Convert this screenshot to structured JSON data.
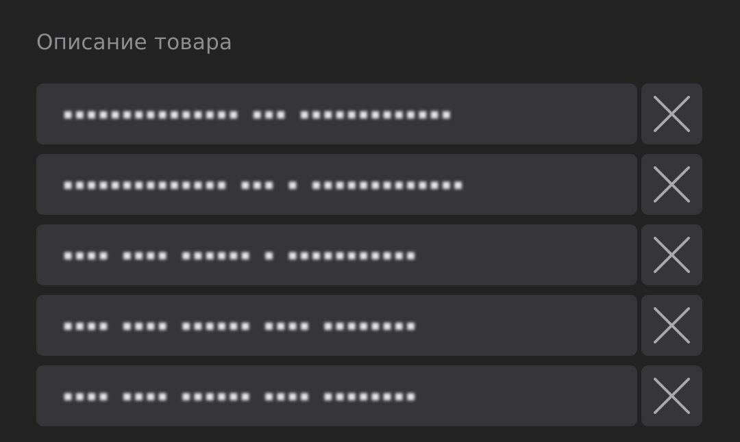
{
  "section": {
    "title": "Описание товара"
  },
  "items": [
    {
      "value": "▪︎▪︎▪︎▪︎▪︎▪︎▪︎▪︎▪︎▪︎▪︎▪︎▪︎▪︎▪︎ ▪︎▪︎▪︎ ▪︎▪︎▪︎▪︎▪︎▪︎▪︎▪︎▪︎▪︎▪︎▪︎▪︎"
    },
    {
      "value": "▪︎▪︎▪︎▪︎▪︎▪︎▪︎▪︎▪︎▪︎▪︎▪︎▪︎▪︎ ▪︎▪︎▪︎ ▪︎ ▪︎▪︎▪︎▪︎▪︎▪︎▪︎▪︎▪︎▪︎▪︎▪︎▪︎"
    },
    {
      "value": "▪︎▪︎▪︎▪︎ ▪︎▪︎▪︎▪︎ ▪︎▪︎▪︎▪︎▪︎▪︎ ▪︎ ▪︎▪︎▪︎▪︎▪︎▪︎▪︎▪︎▪︎▪︎▪︎"
    },
    {
      "value": "▪︎▪︎▪︎▪︎ ▪︎▪︎▪︎▪︎ ▪︎▪︎▪︎▪︎▪︎▪︎ ▪︎▪︎▪︎▪︎ ▪︎▪︎▪︎▪︎▪︎▪︎▪︎▪︎"
    },
    {
      "value": "▪︎▪︎▪︎▪︎ ▪︎▪︎▪︎▪︎ ▪︎▪︎▪︎▪︎▪︎▪︎ ▪︎▪︎▪︎▪︎ ▪︎▪︎▪︎▪︎▪︎▪︎▪︎▪︎"
    }
  ],
  "icons": {
    "remove": "close-icon"
  },
  "colors": {
    "background": "#232324",
    "field": "#363638",
    "title_text": "#8e8e90",
    "value_text": "#e6e6e8",
    "icon": "#a9a9ab"
  }
}
